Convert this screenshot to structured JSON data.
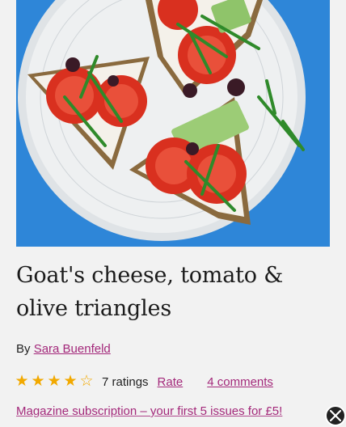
{
  "recipe": {
    "title": "Goat's cheese, tomato & olive triangles",
    "byline_prefix": "By",
    "author": "Sara Buenfeld",
    "rating": 4,
    "rating_max": 5,
    "ratings_count": "7 ratings",
    "rate_label": "Rate",
    "comments_label": "4 comments"
  },
  "promo": {
    "text": "Magazine subscription – your first 5 issues for £5!"
  },
  "icons": {
    "close": "close-icon",
    "star_filled": "star-filled-icon",
    "star_empty": "star-empty-icon"
  },
  "colors": {
    "link": "#a3287a",
    "star": "#f2a900",
    "hero_bg": "#2e86d8"
  }
}
